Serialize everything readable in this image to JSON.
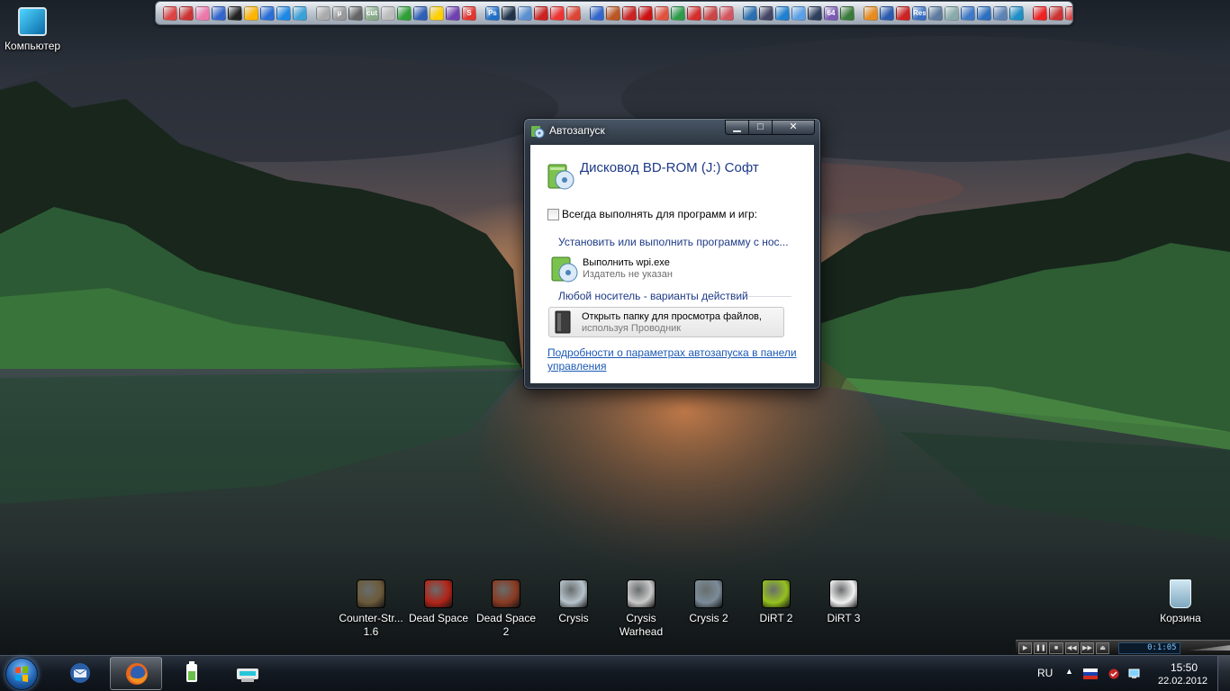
{
  "desktop": {
    "computer_label": "Компьютер",
    "recycle_label": "Корзина",
    "games": [
      {
        "label": "Counter-Str... 1.6",
        "icon": "counter-strike-icon",
        "color": "#6b5a3a"
      },
      {
        "label": "Dead Space",
        "icon": "dead-space-icon",
        "color": "#b22418"
      },
      {
        "label": "Dead Space 2",
        "icon": "dead-space-2-icon",
        "color": "#8a3a22"
      },
      {
        "label": "Crysis",
        "icon": "crysis-icon",
        "color": "#b7c3cc"
      },
      {
        "label": "Crysis Warhead",
        "icon": "crysis-warhead-icon",
        "color": "#c9c9c9"
      },
      {
        "label": "Crysis 2",
        "icon": "crysis-2-icon",
        "color": "#7b8c99"
      },
      {
        "label": "DiRT 2",
        "icon": "dirt-2-icon",
        "color": "#95c11e"
      },
      {
        "label": "DiRT 3",
        "icon": "dirt-3-icon",
        "color": "#f2f2f2"
      }
    ]
  },
  "quickbar": {
    "icons": [
      "#d44",
      "#c33",
      "#e7a",
      "#36c",
      "#222",
      "#ffb400",
      "#2a6fd6",
      "#1e88e5",
      "#3aa0d8",
      "#aaa",
      "#999",
      "#666",
      "#8a8",
      "#bbb",
      "#2e9e35",
      "#2f5fb6",
      "#ffd000",
      "#7040b0",
      "#e3342f",
      "#1f6fc7",
      "#20334a",
      "#5a8fd0",
      "#c22",
      "#e33",
      "#d43",
      "#3366cc",
      "#b52",
      "#cc2222",
      "#c11",
      "#e1523d",
      "#2d9b4a",
      "#d62d2d",
      "#c44",
      "#d5555f",
      "#2a6fb0",
      "#446",
      "#1f7fd0",
      "#5aa0e8",
      "#2d3f5c",
      "#7b5ab3",
      "#3a7b3a",
      "#e88a1c",
      "#2a5bb0",
      "#c22",
      "#3a6fc2",
      "#5d7a9e",
      "#8aa",
      "#3f78c7",
      "#2c6fc0",
      "#5d83b5",
      "#1e8ec7",
      "#e22",
      "#c33",
      "#d44",
      "#d33",
      "#0b8fd8",
      "#2e9e35",
      "#3b6ed2",
      "#ffb400",
      "#e2a000",
      "#8ab"
    ],
    "badges": {
      "utorrent": "µ",
      "photoshop": "Ps",
      "skype": "S",
      "cut": "cut",
      "res": "Res",
      "sixtyfour": "64"
    }
  },
  "autoplay": {
    "window_title": "Автозапуск",
    "drive_title": "Дисковод BD-ROM (J:) Софт",
    "always_label": "Всегда выполнять для программ и игр:",
    "always_checked": false,
    "section_install": "Установить или выполнить программу с нос...",
    "run_title": "Выполнить wpi.exe",
    "run_publisher": "Издатель не указан",
    "section_general": "Любой носитель - варианты действий",
    "open_title": "Открыть папку для просмотра файлов,",
    "open_sub": "используя Проводник",
    "details_link": "Подробности о параметрах автозапуска в панели управления",
    "btn_min": "▁",
    "btn_max": "□",
    "btn_close": "✕"
  },
  "player": {
    "time": "0:1:05",
    "buttons": [
      "▶",
      "❚❚",
      "■",
      "◀◀",
      "▶▶",
      "⏏"
    ]
  },
  "taskbar": {
    "items": [
      {
        "name": "thunderbird",
        "icon": "thunderbird-icon",
        "active": false
      },
      {
        "name": "firefox",
        "icon": "firefox-icon",
        "active": true
      },
      {
        "name": "battery-utility",
        "icon": "battery-app-icon",
        "active": false
      },
      {
        "name": "printer",
        "icon": "printer-app-icon",
        "active": false
      }
    ],
    "lang": "RU",
    "tray_arrow": "▲",
    "time": "15:50",
    "date": "22.02.2012"
  },
  "colors": {
    "link": "#1c5ab5",
    "heading": "#1e3a87",
    "taskbar": "#141a22"
  }
}
